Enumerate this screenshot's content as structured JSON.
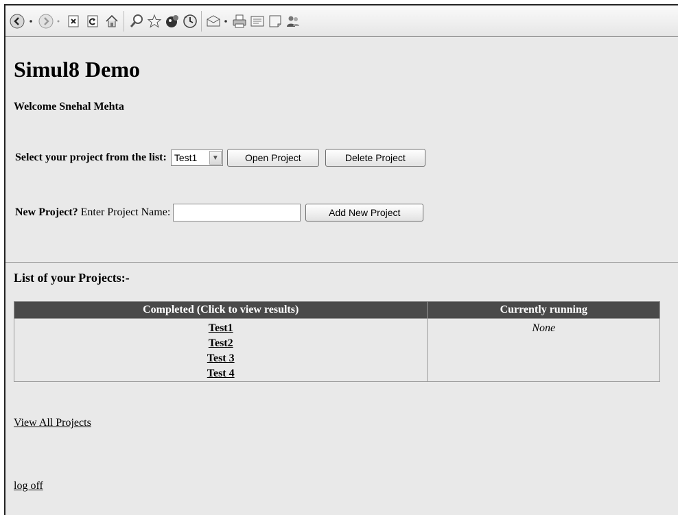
{
  "toolbar": {
    "icons": [
      "back-icon",
      "dropdown-icon",
      "forward-icon",
      "dropdown-icon",
      "stop-icon",
      "refresh-icon",
      "home-icon",
      "search-icon",
      "favorites-icon",
      "media-icon",
      "history-icon",
      "mail-icon",
      "dropdown-icon",
      "print-icon",
      "edit-icon",
      "discuss-icon",
      "messenger-icon"
    ]
  },
  "page": {
    "title": "Simul8 Demo",
    "welcome": "Welcome Snehal Mehta"
  },
  "project_select": {
    "label": "Select your project from the list:",
    "selected": "Test1",
    "open_label": "Open Project",
    "delete_label": "Delete Project"
  },
  "new_project": {
    "label_bold": "New Project?",
    "label_rest": "Enter Project Name:",
    "value": "",
    "add_label": "Add New Project"
  },
  "projects": {
    "heading": "List of your Projects:-",
    "col_completed": "Completed (Click to view results)",
    "col_running": "Currently running",
    "completed": [
      "Test1",
      "Test2",
      "Test 3",
      "Test 4"
    ],
    "running": "None"
  },
  "links": {
    "view_all": "View All Projects",
    "log_off": "log off"
  }
}
